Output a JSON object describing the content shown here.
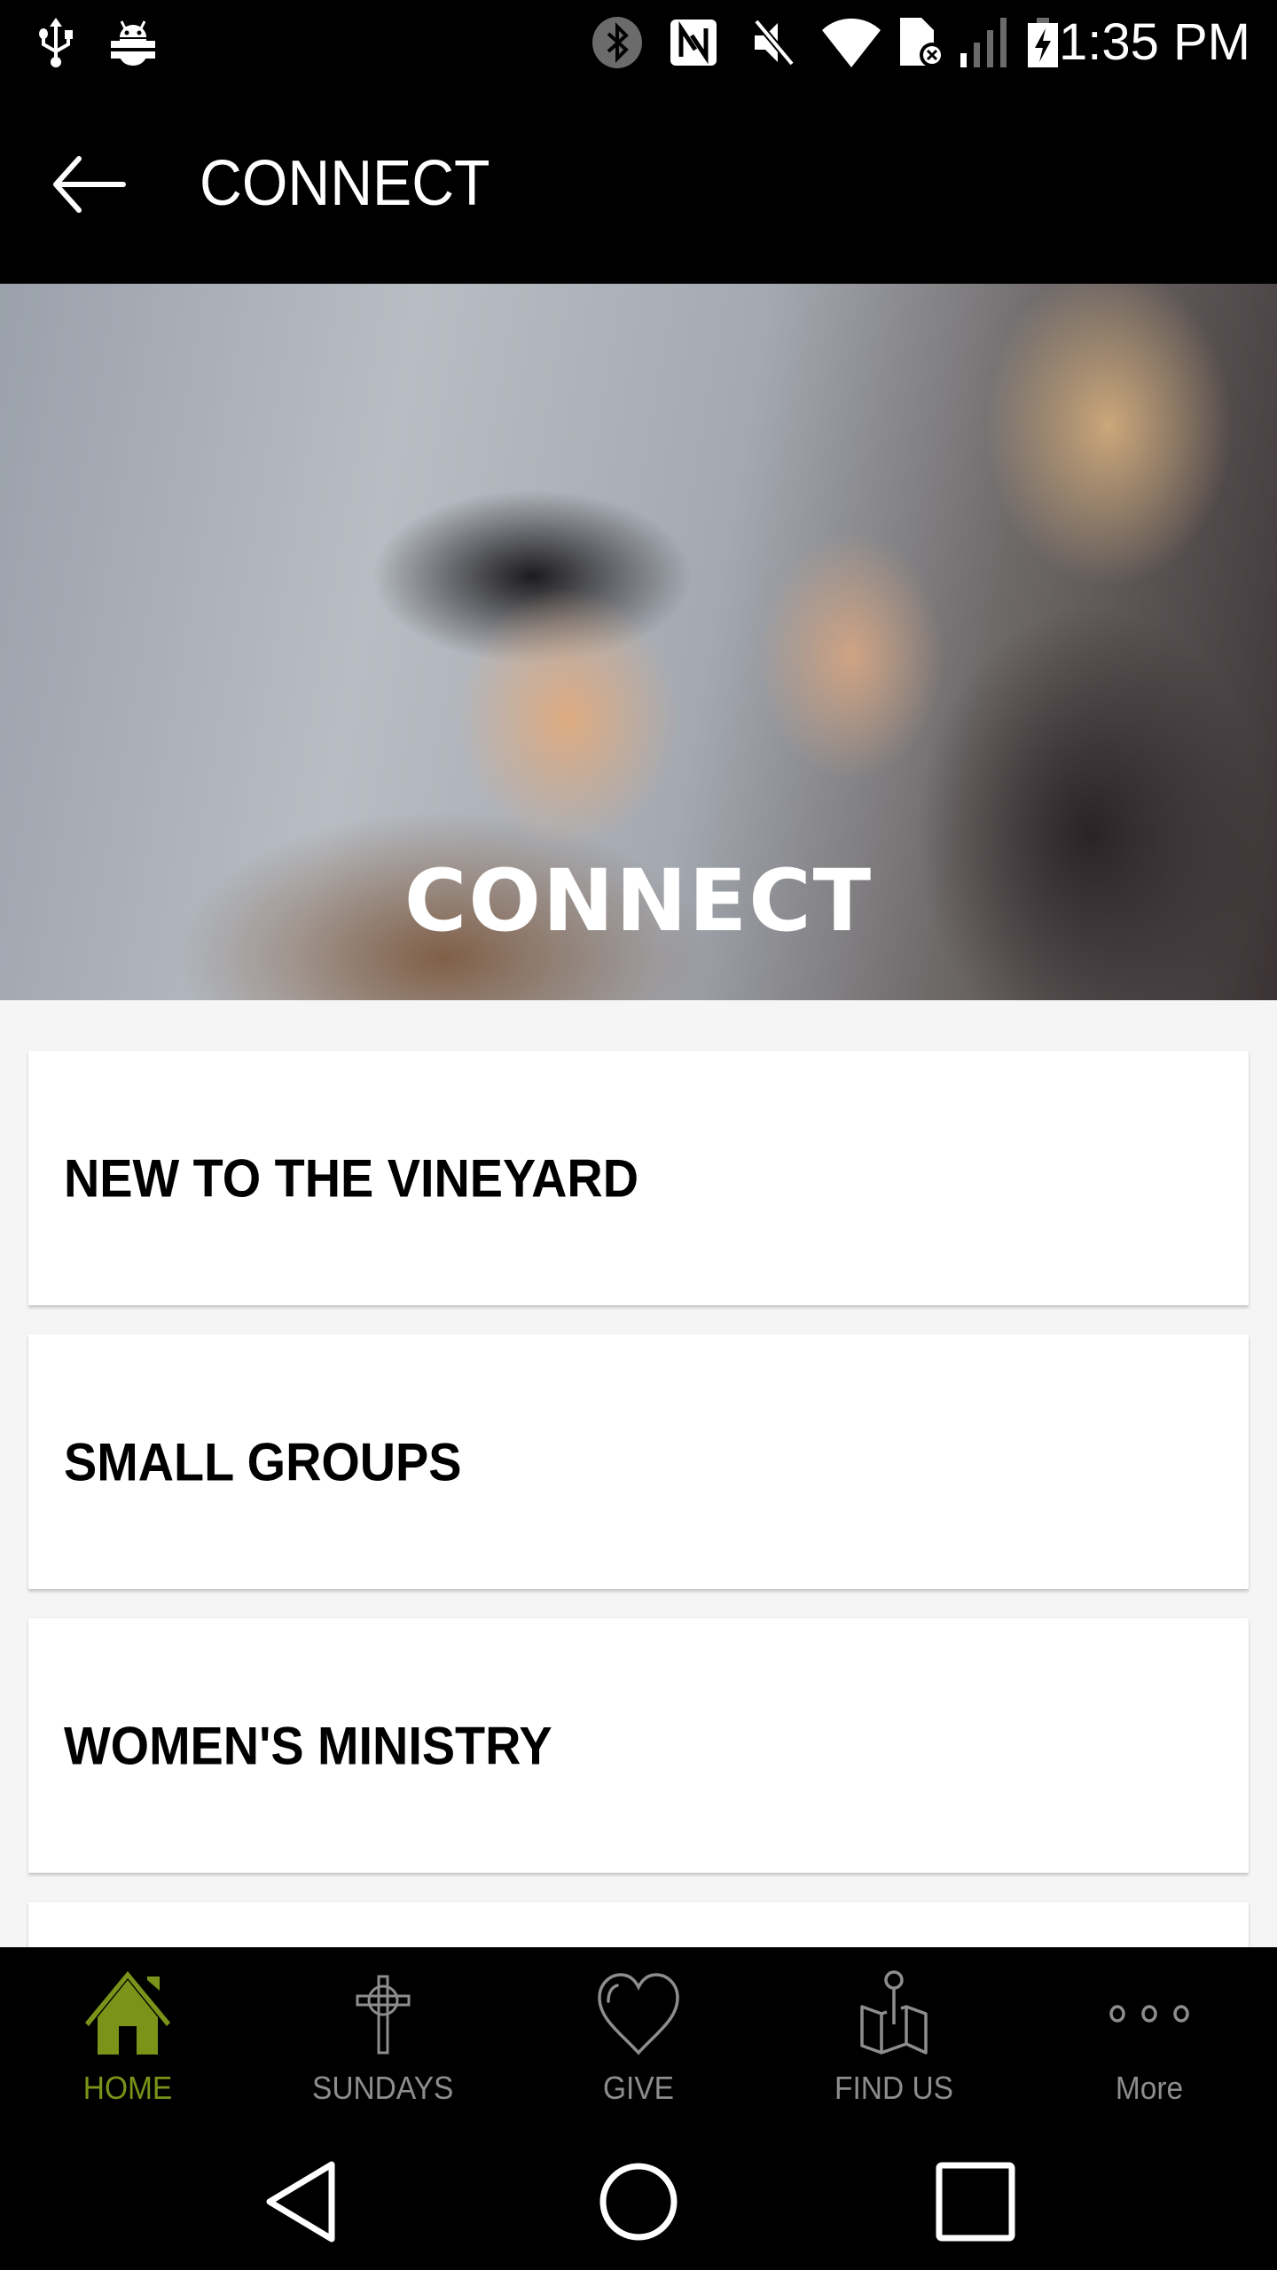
{
  "status_bar": {
    "time": "1:35 PM",
    "left_icons": [
      "usb-icon",
      "android-debug-icon"
    ],
    "right_icons": [
      "bluetooth-icon",
      "nfc-icon",
      "mute-icon",
      "wifi-icon",
      "no-sim-icon",
      "signal-icon",
      "battery-charging-icon"
    ]
  },
  "toolbar": {
    "back_icon": "arrow-left-icon",
    "title": "CONNECT"
  },
  "hero": {
    "title": "CONNECT"
  },
  "cards": [
    {
      "label": "NEW TO THE VINEYARD"
    },
    {
      "label": "SMALL GROUPS"
    },
    {
      "label": "WOMEN'S MINISTRY"
    },
    {
      "label": ""
    }
  ],
  "bottom_nav": {
    "active_color": "#7a9318",
    "inactive_color": "#8d8d8d",
    "items": [
      {
        "label": "HOME",
        "icon": "home-icon",
        "active": true
      },
      {
        "label": "SUNDAYS",
        "icon": "cross-icon",
        "active": false
      },
      {
        "label": "GIVE",
        "icon": "heart-icon",
        "active": false
      },
      {
        "label": "FIND US",
        "icon": "map-pin-icon",
        "active": false
      },
      {
        "label": "More",
        "icon": "more-dots-icon",
        "active": false
      }
    ]
  },
  "system_nav": {
    "buttons": [
      "back-triangle-icon",
      "home-circle-icon",
      "recents-square-icon"
    ]
  }
}
